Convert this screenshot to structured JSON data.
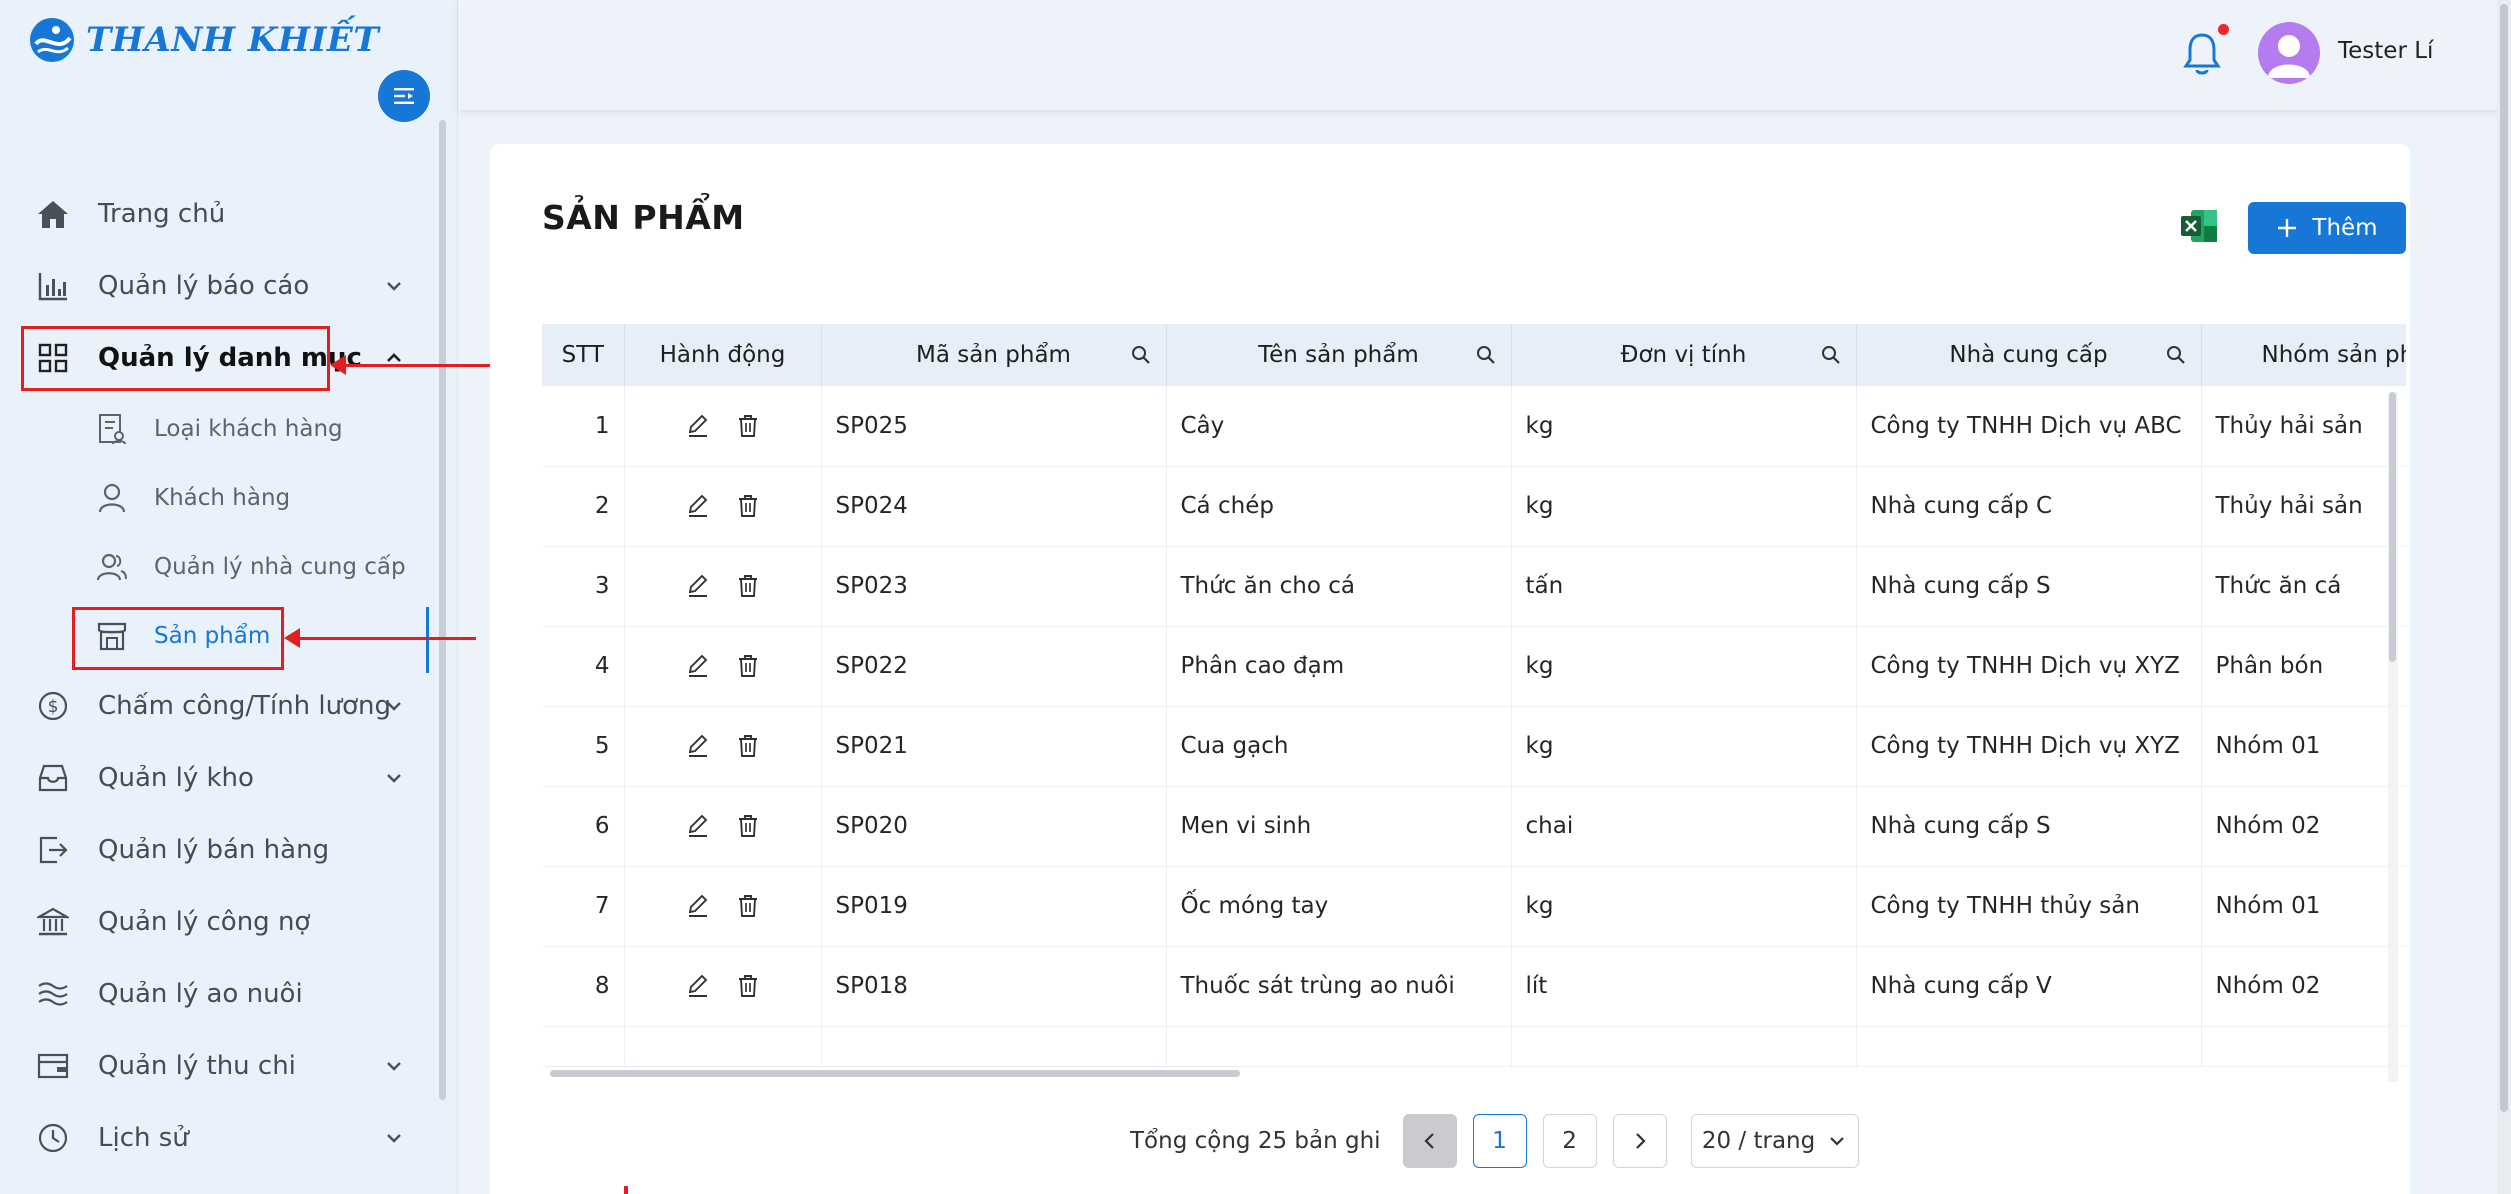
{
  "brand": {
    "name": "THANH KHIẾT"
  },
  "header": {
    "user_name": "Tester Lí"
  },
  "sidebar": {
    "items": [
      {
        "label": "Trang chủ",
        "icon": "home-icon",
        "has_chevron": false
      },
      {
        "label": "Quản lý báo cáo",
        "icon": "bar-chart-icon",
        "has_chevron": true
      },
      {
        "label": "Quản lý danh mục",
        "icon": "grid-icon",
        "has_chevron": true,
        "expanded": true
      },
      {
        "label": "Chấm công/Tính lương",
        "icon": "dollar-icon",
        "has_chevron": true
      },
      {
        "label": "Quản lý kho",
        "icon": "inbox-icon",
        "has_chevron": true
      },
      {
        "label": "Quản lý bán hàng",
        "icon": "export-icon",
        "has_chevron": false
      },
      {
        "label": "Quản lý công nợ",
        "icon": "bank-icon",
        "has_chevron": false
      },
      {
        "label": "Quản lý ao nuôi",
        "icon": "waves-icon",
        "has_chevron": false
      },
      {
        "label": "Quản lý thu chi",
        "icon": "wallet-icon",
        "has_chevron": true
      },
      {
        "label": "Lịch sử",
        "icon": "clock-icon",
        "has_chevron": true
      }
    ],
    "sub_items": [
      {
        "label": "Loại khách hàng",
        "icon": "profile-icon"
      },
      {
        "label": "Khách hàng",
        "icon": "user-icon"
      },
      {
        "label": "Quản lý nhà cung cấp",
        "icon": "team-icon"
      },
      {
        "label": "Sản phẩm",
        "icon": "shop-icon",
        "selected": true
      }
    ]
  },
  "page": {
    "title": "SẢN PHẨM",
    "add_label": "Thêm"
  },
  "table": {
    "columns": [
      "STT",
      "Hành động",
      "Mã sản phẩm",
      "Tên sản phẩm",
      "Đơn vị tính",
      "Nhà cung cấp",
      "Nhóm sản phẩm"
    ],
    "rows": [
      {
        "stt": "1",
        "code": "SP025",
        "name": "Cây",
        "unit": "kg",
        "supplier": "Công ty TNHH Dịch vụ ABC",
        "group": "Thủy hải sản"
      },
      {
        "stt": "2",
        "code": "SP024",
        "name": "Cá chép",
        "unit": "kg",
        "supplier": "Nhà cung cấp C",
        "group": "Thủy hải sản"
      },
      {
        "stt": "3",
        "code": "SP023",
        "name": "Thức ăn cho cá",
        "unit": "tấn",
        "supplier": "Nhà cung cấp S",
        "group": "Thức ăn cá"
      },
      {
        "stt": "4",
        "code": "SP022",
        "name": "Phân cao đạm",
        "unit": "kg",
        "supplier": "Công ty TNHH Dịch vụ XYZ",
        "group": "Phân bón"
      },
      {
        "stt": "5",
        "code": "SP021",
        "name": "Cua gạch",
        "unit": "kg",
        "supplier": "Công ty TNHH Dịch vụ XYZ",
        "group": "Nhóm 01"
      },
      {
        "stt": "6",
        "code": "SP020",
        "name": "Men vi sinh",
        "unit": "chai",
        "supplier": "Nhà cung cấp S",
        "group": "Nhóm 02"
      },
      {
        "stt": "7",
        "code": "SP019",
        "name": "Ốc móng tay",
        "unit": "kg",
        "supplier": "Công ty TNHH thủy sản",
        "group": "Nhóm 01"
      },
      {
        "stt": "8",
        "code": "SP018",
        "name": "Thuốc sát trùng ao nuôi",
        "unit": "lít",
        "supplier": "Nhà cung cấp V",
        "group": "Nhóm 02"
      }
    ]
  },
  "pagination": {
    "total_text": "Tổng cộng 25 bản ghi",
    "pages": [
      "1",
      "2"
    ],
    "current_page": "1",
    "page_size": "20 / trang"
  },
  "colors": {
    "primary": "#1677d6",
    "annotation_red": "#e02020",
    "excel_green": "#1d6f42"
  }
}
